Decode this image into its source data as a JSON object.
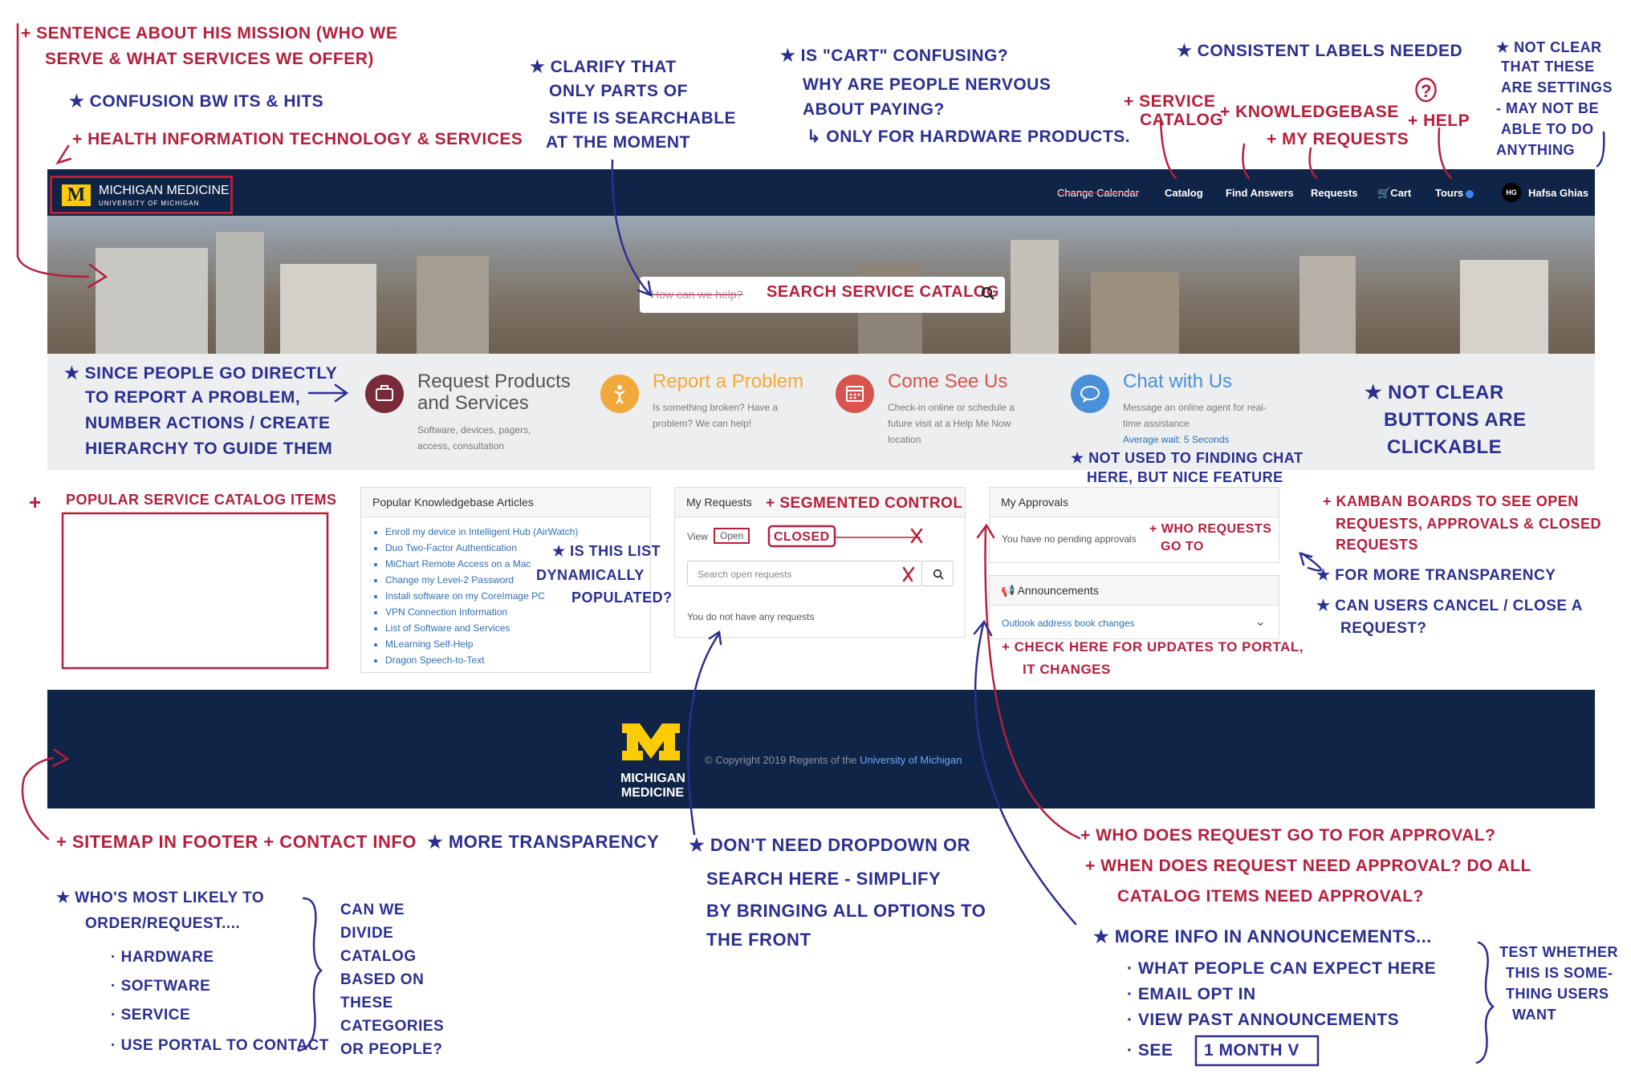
{
  "nav": {
    "brand": "MICHIGAN MEDICINE",
    "brand_sub": "UNIVERSITY OF MICHIGAN",
    "brand_mark": "M",
    "items": [
      "Change Calendar",
      "Catalog",
      "Find Answers",
      "Requests",
      "Cart",
      "Tours"
    ],
    "avatar_initials": "HG",
    "user_name": "Hafsa Ghias"
  },
  "search": {
    "placeholder": "How can we help?",
    "overlay_note": "SEARCH SERVICE CATALOG"
  },
  "actions": [
    {
      "title": "Request Products and Services",
      "desc": "Software, devices, pagers, access, consultation",
      "color": "#7a2b3a",
      "icon": "briefcase-icon"
    },
    {
      "title": "Report a Problem",
      "desc": "Is something broken? Have a problem? We can help!",
      "color": "#f2a93b",
      "icon": "person-icon"
    },
    {
      "title": "Come See Us",
      "desc": "Check-in online or schedule a future visit at a Help Me Now location",
      "color": "#d9534f",
      "icon": "calendar-icon"
    },
    {
      "title": "Chat with Us",
      "desc": "Message an online agent for real-time assistance",
      "wait": "Average wait: 5 Seconds",
      "color": "#4a90d9",
      "icon": "chat-icon"
    }
  ],
  "kb": {
    "title": "Popular Knowledgebase Articles",
    "articles": [
      "Enroll my device in Intelligent Hub (AirWatch)",
      "Duo Two-Factor Authentication",
      "MiChart Remote Access on a Mac",
      "Change my Level-2 Password",
      "Install software on my CoreImage PC",
      "VPN Connection Information",
      "List of Software and Services",
      "MLearning Self-Help",
      "Dragon Speech-to-Text"
    ]
  },
  "requests": {
    "title": "My Requests",
    "view_label": "View",
    "view_value": "Open",
    "search_placeholder": "Search open requests",
    "empty": "You do not have any requests"
  },
  "approvals": {
    "title": "My Approvals",
    "empty": "You have no pending approvals"
  },
  "announcements": {
    "title": "Announcements",
    "item": "Outlook address book changes"
  },
  "footer": {
    "logo_line1": "MICHIGAN",
    "logo_line2": "MEDICINE",
    "copyright": "© Copyright 2019 Regents of the",
    "copyright_link": "University of Michigan"
  },
  "notes": {
    "mission1": "+ SENTENCE ABOUT HIS MISSION (WHO WE",
    "mission2": "SERVE & WHAT SERVICES WE OFFER)",
    "its": "★ CONFUSION BW ITS & HITS",
    "health": "+ HEALTH INFORMATION TECHNOLOGY & SERVICES",
    "searchable1": "★ CLARIFY THAT",
    "searchable2": "ONLY PARTS OF",
    "searchable3": "SITE IS SEARCHABLE",
    "searchable4": "AT THE MOMENT",
    "cart1": "★ IS \"CART\" CONFUSING?",
    "cart2": "WHY ARE PEOPLE NERVOUS",
    "cart3": "ABOUT PAYING?",
    "cart4": "↳ ONLY FOR HARDWARE PRODUCTS.",
    "labels": "★ CONSISTENT LABELS NEEDED",
    "svc1": "+ SERVICE",
    "svc2": "CATALOG",
    "kbl": "+ KNOWLEDGEBASE",
    "myreq": "+ MY REQUESTS",
    "help_q": "?",
    "help": "+ HELP",
    "settings1": "★ NOT CLEAR",
    "settings2": "THAT THESE",
    "settings3": "ARE SETTINGS",
    "settings4": "- MAY NOT BE",
    "settings5": "ABLE TO DO",
    "settings6": "ANYTHING",
    "direct1": "★ SINCE PEOPLE GO DIRECTLY",
    "direct2": "TO REPORT A PROBLEM,",
    "direct3": "NUMBER ACTIONS / CREATE",
    "direct4": "HIERARCHY TO GUIDE THEM",
    "buttons1": "★ NOT CLEAR",
    "buttons2": "BUTTONS ARE",
    "buttons3": "CLICKABLE",
    "chat1": "★ NOT USED TO FINDING CHAT",
    "chat2": "HERE, BUT NICE FEATURE",
    "popular": "POPULAR SERVICE CATALOG ITEMS",
    "plus": "+",
    "dyn1": "★ IS THIS LIST",
    "dyn2": "DYNAMICALLY",
    "dyn3": "POPULATED?",
    "segmented": "+ SEGMENTED CONTROL",
    "closed": "CLOSED",
    "who_req1": "+ WHO REQUESTS",
    "who_req2": "GO TO",
    "kanban1": "+ KAMBAN BOARDS TO SEE OPEN",
    "kanban2": "REQUESTS, APPROVALS & CLOSED",
    "kanban3": "REQUESTS",
    "transp": "★ FOR MORE TRANSPARENCY",
    "cancel1": "★ CAN USERS CANCEL / CLOSE A",
    "cancel2": "REQUEST?",
    "check1": "+ CHECK HERE FOR UPDATES TO PORTAL,",
    "check2": "IT CHANGES",
    "sitemap": "+ SITEMAP IN FOOTER + CONTACT INFO",
    "more_tr": "★ MORE TRANSPARENCY",
    "dropdown1": "★ DON'T NEED DROPDOWN OR",
    "dropdown2": "SEARCH HERE - SIMPLIFY",
    "dropdown3": "BY BRINGING ALL OPTIONS TO",
    "dropdown4": "THE FRONT",
    "approval1": "+ WHO DOES REQUEST GO TO FOR APPROVAL?",
    "approval2": "+ WHEN DOES REQUEST NEED APPROVAL? DO ALL",
    "approval3": "CATALOG ITEMS NEED APPROVAL?",
    "order1": "★ WHO'S MOST LIKELY TO",
    "order2": "ORDER/REQUEST....",
    "order3": "· HARDWARE",
    "order4": "· SOFTWARE",
    "order5": "· SERVICE",
    "order6": "· USE PORTAL TO CONTACT",
    "divide1": "CAN WE",
    "divide2": "DIVIDE",
    "divide3": "CATALOG",
    "divide4": "BASED ON",
    "divide5": "THESE",
    "divide6": "CATEGORIES",
    "divide7": "OR PEOPLE?",
    "ann1": "★ MORE INFO IN ANNOUNCEMENTS...",
    "ann2": "· WHAT PEOPLE CAN EXPECT HERE",
    "ann3": "· EMAIL OPT IN",
    "ann4": "· VIEW PAST ANNOUNCEMENTS",
    "ann5": "· SEE",
    "ann6": "1 MONTH V",
    "test1": "TEST WHETHER",
    "test2": "THIS IS SOME-",
    "test3": "THING USERS",
    "test4": "WANT"
  }
}
